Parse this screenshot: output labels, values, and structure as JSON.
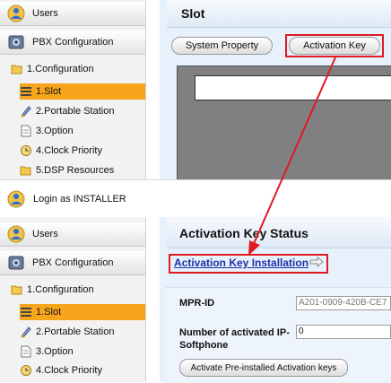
{
  "top": {
    "sidebar": {
      "users_label": "Users",
      "pbx_label": "PBX Configuration",
      "items": [
        {
          "label": "1.Configuration"
        },
        {
          "label": "1.Slot"
        },
        {
          "label": "2.Portable Station"
        },
        {
          "label": "3.Option"
        },
        {
          "label": "4.Clock Priority"
        },
        {
          "label": "5.DSP Resources"
        }
      ]
    },
    "title": "Slot",
    "buttons": {
      "system_property": "System Property",
      "activation_key": "Activation Key"
    }
  },
  "login_bar": {
    "text": "Login as INSTALLER"
  },
  "bottom": {
    "sidebar": {
      "users_label": "Users",
      "pbx_label": "PBX Configuration",
      "items": [
        {
          "label": "1.Configuration"
        },
        {
          "label": "1.Slot"
        },
        {
          "label": "2.Portable Station"
        },
        {
          "label": "3.Option"
        },
        {
          "label": "4.Clock Priority"
        }
      ]
    },
    "title": "Activation Key Status",
    "link": "Activation Key Installation",
    "fields": {
      "mpr_label": "MPR-ID",
      "mpr_value": "A201-0909-420B-CE7",
      "ip_softphone_label_1": "Number of activated IP-",
      "ip_softphone_label_2": "Softphone",
      "ip_softphone_value": "0"
    },
    "activate_button": "Activate Pre-installed Activation keys"
  },
  "colors": {
    "selected": "#f7a51c",
    "annotation_red": "#e01a22",
    "panel_blue": "#e7f1fb",
    "title_bar": "#dfe9f5"
  }
}
